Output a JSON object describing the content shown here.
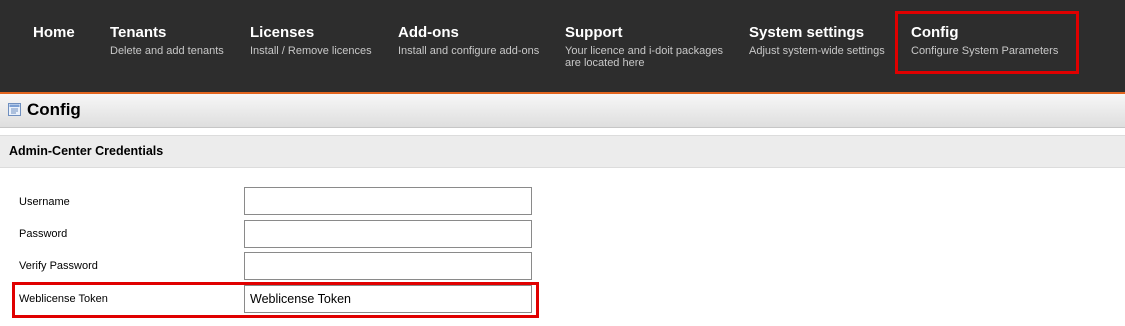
{
  "nav": {
    "items": [
      {
        "title": "Home",
        "desc": ""
      },
      {
        "title": "Tenants",
        "desc": "Delete and add tenants"
      },
      {
        "title": "Licenses",
        "desc": "Install / Remove licences"
      },
      {
        "title": "Add-ons",
        "desc": "Install and configure add-ons"
      },
      {
        "title": "Support",
        "desc_line1": "Your licence and i-doit packages",
        "desc_line2": "are located here"
      },
      {
        "title": "System settings",
        "desc": "Adjust system-wide settings"
      },
      {
        "title": "Config",
        "desc": "Configure System Parameters"
      }
    ],
    "active": "Config",
    "accent_color": "#e2651f",
    "highlight_color": "#e00000"
  },
  "page": {
    "title": "Config",
    "title_icon": "config-document-icon"
  },
  "section": {
    "title": "Admin-Center Credentials"
  },
  "form": {
    "username": {
      "label": "Username",
      "value": "",
      "placeholder": ""
    },
    "password": {
      "label": "Password",
      "value": "",
      "placeholder": ""
    },
    "verify_password": {
      "label": "Verify Password",
      "value": "",
      "placeholder": ""
    },
    "weblicense_token": {
      "label": "Weblicense Token",
      "value": "",
      "placeholder": "Weblicense Token"
    }
  }
}
